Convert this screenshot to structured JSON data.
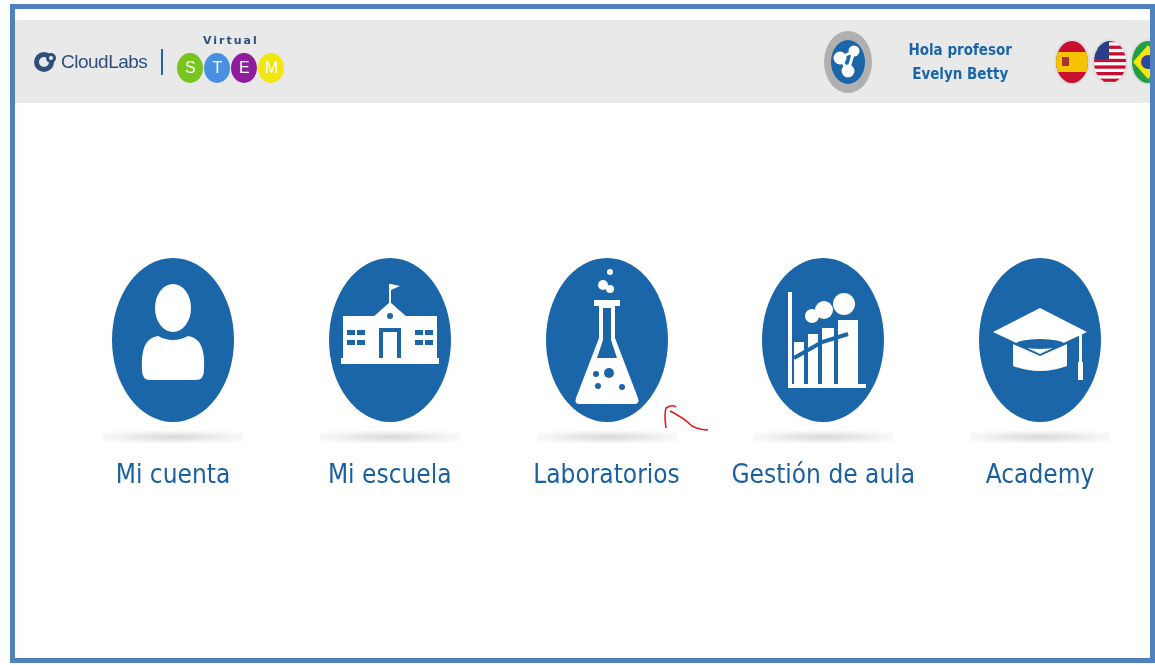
{
  "header": {
    "brand": "CloudLabs",
    "tagline": "Virtual",
    "stem_letters": [
      {
        "letter": "S",
        "color": "#7ac41f"
      },
      {
        "letter": "T",
        "color": "#4a90e2"
      },
      {
        "letter": "E",
        "color": "#8e1e9c"
      },
      {
        "letter": "M",
        "color": "#f2e60f"
      }
    ],
    "greeting": "Hola profesor",
    "user_name": "Evelyn Betty",
    "languages": [
      {
        "kind": "spain"
      },
      {
        "kind": "usa"
      },
      {
        "kind": "brazil"
      }
    ]
  },
  "menu": [
    {
      "kind": "account",
      "label": "Mi cuenta"
    },
    {
      "kind": "school",
      "label": "Mi escuela"
    },
    {
      "kind": "lab",
      "label": "Laboratorios"
    },
    {
      "kind": "classroom",
      "label": "Gestión de aula"
    },
    {
      "kind": "academy",
      "label": "Academy"
    }
  ]
}
